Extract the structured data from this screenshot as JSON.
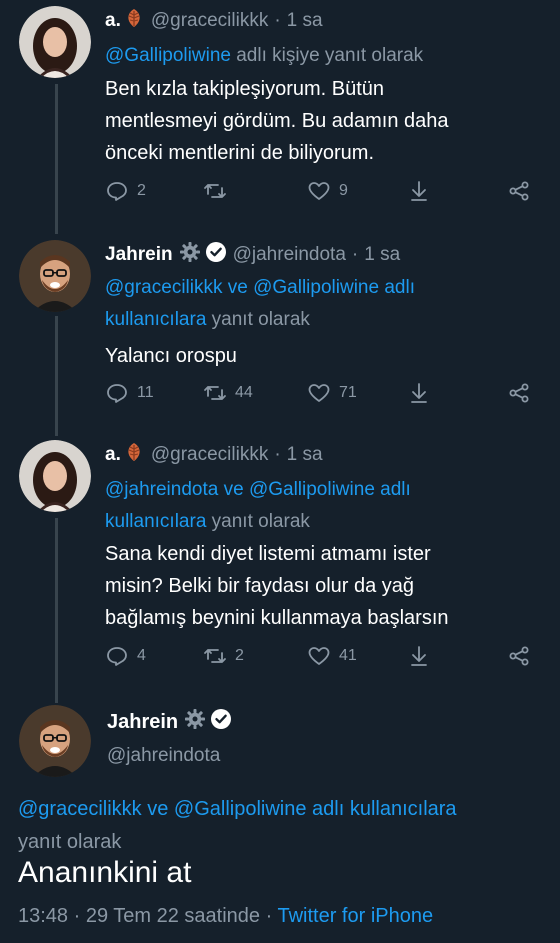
{
  "colors": {
    "background": "#15202b",
    "link": "#1d9bf0",
    "muted": "#8b98a5",
    "divider": "#38444d"
  },
  "tweets": [
    {
      "name": "a.",
      "name_emoji": "leaf-icon",
      "handle": "@gracecilikkk",
      "time": "1 sa",
      "reply_to": "@Gallipoliwine",
      "reply_suffix": " adlı kişiye yanıt olarak",
      "line1": "Ben kızla takipleşiyorum. Bütün",
      "line2": "mentlesmeyi gördüm. Bu adamın daha",
      "line3": "önceki mentlerini de biliyorum.",
      "replies": "2",
      "retweets": "",
      "likes": "9"
    },
    {
      "name": "Jahrein",
      "handle": "@jahreindota",
      "time": "1 sa",
      "reply_to_1": "@gracecilikkk",
      "reply_and": " ve ",
      "reply_to_2": "@Gallipoliwine adlı",
      "reply_line2_link": "kullanıcılara",
      "reply_line2_rest": " yanıt olarak",
      "line1": "Yalancı orospu",
      "replies": "11",
      "retweets": "44",
      "likes": "71"
    },
    {
      "name": "a.",
      "name_emoji": "leaf-icon",
      "handle": "@gracecilikkk",
      "time": "1 sa",
      "reply_to_1": "@jahreindota",
      "reply_and": " ve ",
      "reply_to_2": "@Gallipoliwine adlı",
      "reply_line2_link": "kullanıcılara",
      "reply_line2_rest": " yanıt olarak",
      "line1": "Sana kendi diyet listemi atmamı ister",
      "line2": "misin? Belki bir faydası olur da yağ",
      "line3": "bağlamış beynini kullanmaya başlarsın",
      "replies": "4",
      "retweets": "2",
      "likes": "41"
    }
  ],
  "main": {
    "name": "Jahrein",
    "handle": "@jahreindota",
    "reply_line1": "@gracecilikkk ve @Gallipoliwine adlı kullanıcılara",
    "reply_line2": "yanıt olarak",
    "text": "Ananınkini at",
    "time": "13:48",
    "date": "29 Tem 22 saatinde",
    "source": "Twitter for iPhone"
  }
}
